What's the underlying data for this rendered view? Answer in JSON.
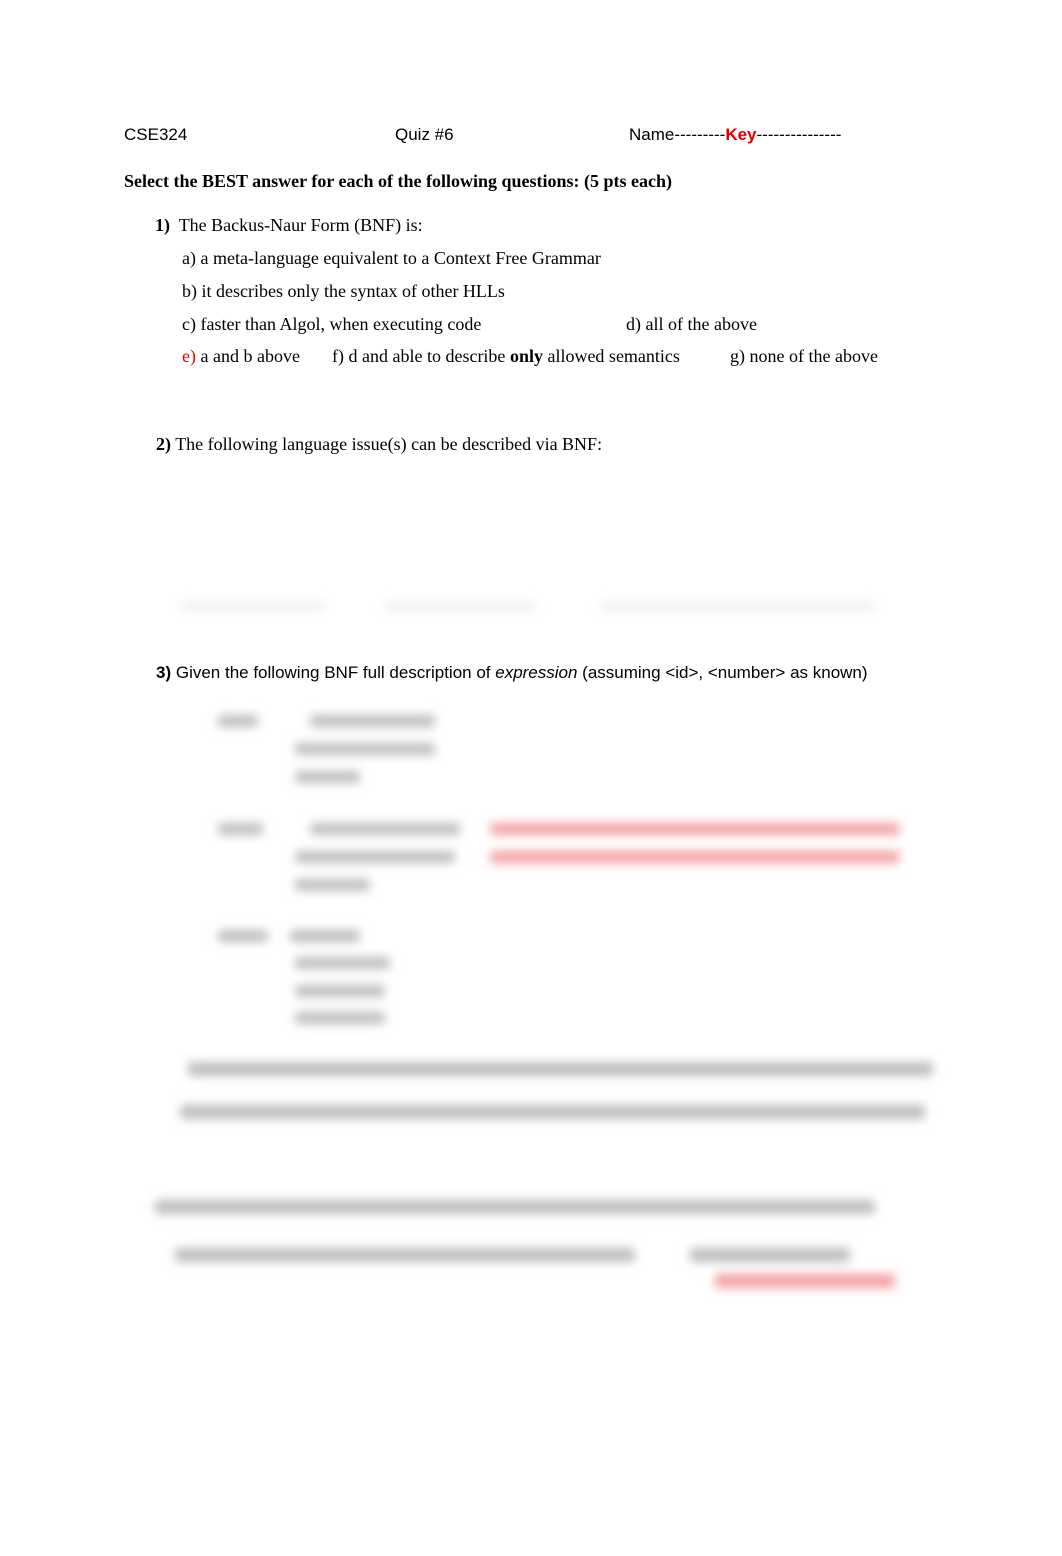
{
  "header": {
    "course": "CSE324",
    "quiz": "Quiz #6",
    "name_prefix": "Name---------",
    "name_value": "Key",
    "name_suffix": "---------------"
  },
  "instructions": "Select the BEST answer for each of the following questions: (5 pts each)",
  "q1": {
    "num": "1)",
    "text": "The Backus-Naur Form (BNF) is:",
    "a": "a) a meta-language equivalent to a Context Free Grammar",
    "b": "b) it describes only the syntax of other HLLs",
    "c": "c) faster than Algol, when executing code",
    "d": "d) all of the above",
    "e_label": "e)",
    "e_text": " a and b above",
    "f_pre": "f) d and able to describe ",
    "f_bold": "only",
    "f_post": " allowed semantics",
    "g": "g) none of the above"
  },
  "q2": {
    "num": "2)",
    "text": "The following language issue(s) can be described via BNF:"
  },
  "q3": {
    "num": "3)",
    "text_pre": " Given the following BNF full description of ",
    "text_italic": "expression",
    "text_post": " (assuming <id>, <number> as known)"
  },
  "colors": {
    "answer_red": "#e00000"
  }
}
